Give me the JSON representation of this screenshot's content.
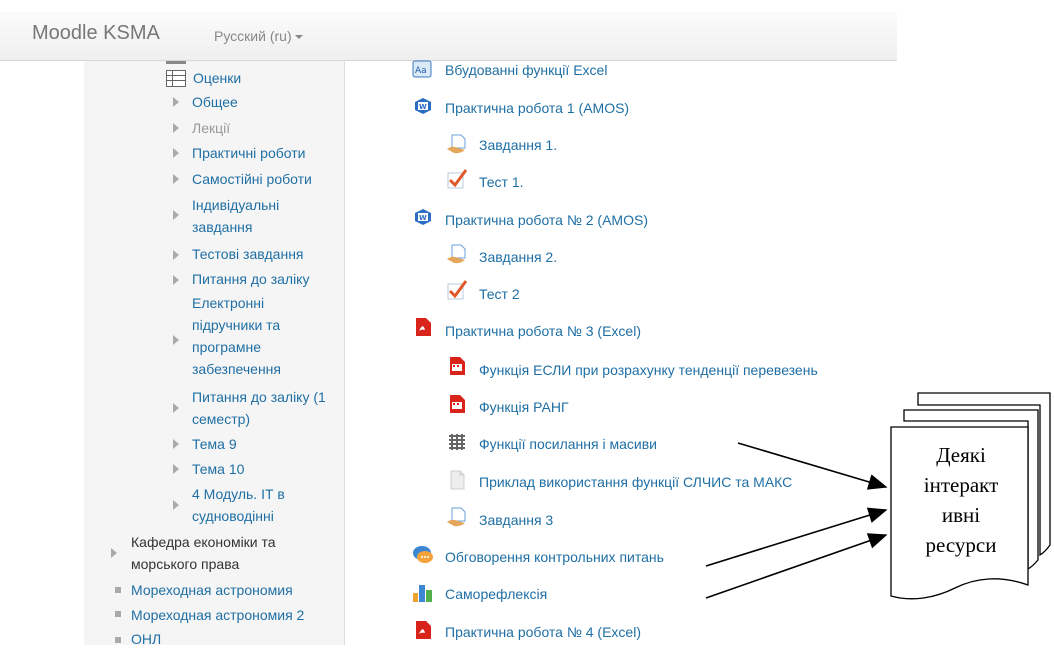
{
  "navbar": {
    "brand": "Moodle KSMA",
    "language": "Русский (ru)"
  },
  "sidebar": {
    "items": [
      {
        "label": "Оценки"
      },
      {
        "label": "Общее"
      },
      {
        "label": "Лекції"
      },
      {
        "label": "Практичні роботи"
      },
      {
        "label": "Самостійні роботи"
      },
      {
        "label": "Індивідуальні завдання"
      },
      {
        "label": "Тестові завдання"
      },
      {
        "label": "Питання до заліку"
      },
      {
        "label": "Електронні підручники та програмне забезпечення"
      },
      {
        "label": "Питання до заліку (1 семестр)"
      },
      {
        "label": "Тема 9"
      },
      {
        "label": "Тема 10"
      },
      {
        "label": "4 Модуль. ІТ в судноводінні"
      },
      {
        "label": "Кафедра економіки та морського права"
      },
      {
        "label": "Мореходная астрономия"
      },
      {
        "label": "Мореходная астрономия 2"
      },
      {
        "label": "ОНЛ"
      }
    ]
  },
  "activities": [
    {
      "label": "Вбудованні функції Excel",
      "icon": "glossary-icon"
    },
    {
      "label": "Практична робота 1 (AMOS)",
      "icon": "word-icon"
    },
    {
      "label": "Завдання 1.",
      "icon": "assignment-icon"
    },
    {
      "label": "Тест 1.",
      "icon": "quiz-icon"
    },
    {
      "label": "Практична робота № 2 (AMOS)",
      "icon": "word-icon"
    },
    {
      "label": "Завдання 2.",
      "icon": "assignment-icon"
    },
    {
      "label": "Тест 2",
      "icon": "quiz-icon"
    },
    {
      "label": "Практична робота № 3 (Excel)",
      "icon": "pdf-icon"
    },
    {
      "label": "Функція ЕСЛИ при розрахунку тенденції перевезень",
      "icon": "video-icon"
    },
    {
      "label": "Функція РАНГ",
      "icon": "video-icon"
    },
    {
      "label": "Функції посилання і масиви",
      "icon": "scorm-icon"
    },
    {
      "label": "Приклад використання функції СЛЧИС та МАКС",
      "icon": "file-icon"
    },
    {
      "label": "Завдання 3",
      "icon": "assignment-icon"
    },
    {
      "label": "Обговорення контрольних питань",
      "icon": "forum-icon"
    },
    {
      "label": "Саморефлексія",
      "icon": "feedback-icon"
    },
    {
      "label": "Практична робота № 4 (Excel)",
      "icon": "pdf-icon"
    }
  ],
  "callout": {
    "line1": "Деякі",
    "line2": "інтеракт",
    "line3": "ивні",
    "line4": "ресурси"
  }
}
